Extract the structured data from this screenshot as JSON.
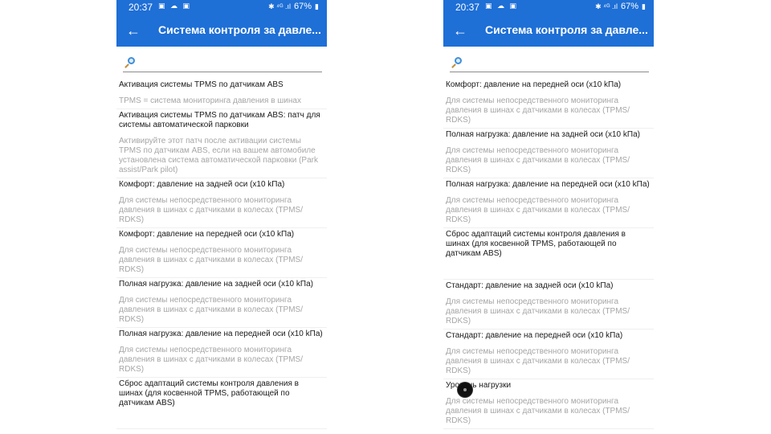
{
  "status": {
    "time": "20:37",
    "notifications": "▣ ☁ ▣",
    "system": "✱ ⁴ᴳ .ıl",
    "battery": "67%"
  },
  "app": {
    "title": "Система контроля за давле..."
  },
  "search": {
    "value": "",
    "placeholder": ""
  },
  "left_items": [
    {
      "title": "Активация системы TPMS по датчикам ABS",
      "desc": "TPMS = система мониторинга давления в шинах"
    },
    {
      "title": "Активация системы TPMS по датчикам ABS: патч для системы автоматической парковки",
      "desc": "Активируйте этот патч после активации системы TPMS по датчикам ABS, если на вашем автомобиле установлена система автоматической парковки (Park assist/Park pilot)"
    },
    {
      "title": "Комфорт: давление на задней оси (x10 kПа)",
      "desc": "Для системы непосредственного мониторинга давления в шинах с датчиками в колесах (TPMS/ RDKS)"
    },
    {
      "title": "Комфорт: давление на передней оси (x10 kПа)",
      "desc": "Для системы непосредственного мониторинга давления в шинах с датчиками в колесах (TPMS/ RDKS)"
    },
    {
      "title": "Полная нагрузка: давление на задней оси (x10 kПа)",
      "desc": "Для системы непосредственного мониторинга давления в шинах с датчиками в колесах (TPMS/ RDKS)"
    },
    {
      "title": "Полная нагрузка: давление на передней оси (x10 kПа)",
      "desc": "Для системы непосредственного мониторинга давления в шинах с датчиками в колесах (TPMS/ RDKS)"
    },
    {
      "title": "Сброс адаптаций системы контроля давления в шинах (для косвенной TPMS, работающей по датчикам ABS)",
      "desc": ""
    }
  ],
  "right_items": [
    {
      "title": "Комфорт: давление на передней оси (x10 kПа)",
      "desc": "Для системы непосредственного мониторинга давления в шинах с датчиками в колесах (TPMS/ RDKS)"
    },
    {
      "title": "Полная нагрузка: давление на задней оси (x10 kПа)",
      "desc": "Для системы непосредственного мониторинга давления в шинах с датчиками в колесах (TPMS/ RDKS)"
    },
    {
      "title": "Полная нагрузка: давление на передней оси (x10 kПа)",
      "desc": "Для системы непосредственного мониторинга давления в шинах с датчиками в колесах (TPMS/ RDKS)"
    },
    {
      "title": "Сброс адаптаций системы контроля давления в шинах (для косвенной TPMS, работающей по датчикам ABS)",
      "desc": ""
    },
    {
      "title": "Стандарт: давление на задней оси (x10 kПа)",
      "desc": "Для системы непосредственного мониторинга давления в шинах с датчиками в колесах (TPMS/ RDKS)"
    },
    {
      "title": "Стандарт: давление на передней оси (x10 kПа)",
      "desc": "Для системы непосредственного мониторинга давления в шинах с датчиками в колесах (TPMS/ RDKS)"
    },
    {
      "title": "Уровень нагрузки",
      "desc": "Для системы непосредственного мониторинга давления в шинах с датчиками в колесах (TPMS/ RDKS)"
    }
  ],
  "colors": {
    "appbar": "#1e6fd6",
    "title_text": "#1a1a1a",
    "desc_text": "#a6a6a6"
  }
}
